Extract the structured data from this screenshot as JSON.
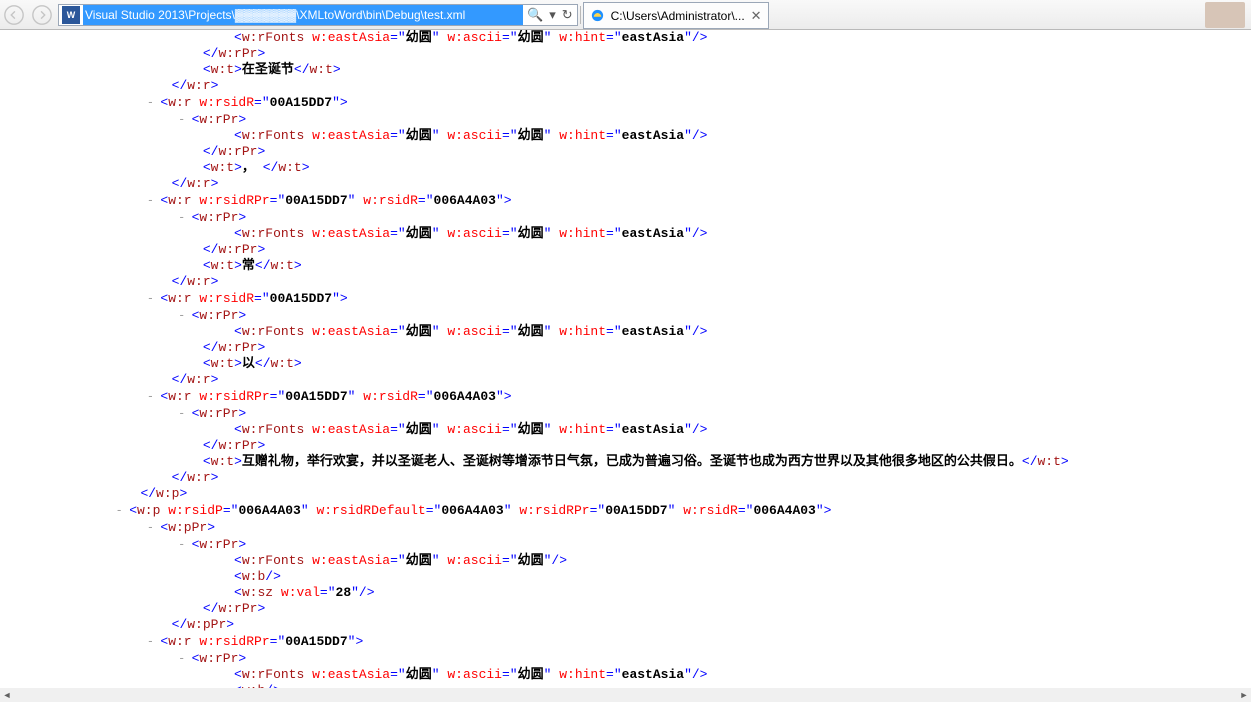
{
  "chrome": {
    "word_icon": "W",
    "address": "Visual Studio 2013\\Projects\\▓▓▓▓▓▓▓\\XMLtoWord\\bin\\Debug\\test.xml",
    "search_icon": "🔍",
    "dropdown_icon": "▾",
    "refresh_icon": "↻",
    "tab_title": "C:\\Users\\Administrator\\...",
    "tab_close": "✕"
  },
  "rsids": {
    "A15": "00A15DD7",
    "A03": "006A4A03"
  },
  "fonts": {
    "youyuan": "幼圆",
    "eastAsia": "eastAsia"
  },
  "text": {
    "t0": "在圣诞节",
    "t1": "，",
    "t2": "常",
    "t3": "以",
    "t4": "互赠礼物，举行欢宴，并以圣诞老人、圣诞树等增添节日气氛，已成为普遍习俗。圣诞节也成为西方世界以及其他很多地区的公共假日。"
  },
  "sz": "28",
  "tags": {
    "wr": "w:r",
    "wrPr": "w:rPr",
    "wrFonts": "w:rFonts",
    "wt": "w:t",
    "wp": "w:p",
    "wpPr": "w:pPr",
    "wb": "w:b",
    "wsz": "w:sz",
    "rsidR": "w:rsidR",
    "rsidRPr": "w:rsidRPr",
    "rsidP": "w:rsidP",
    "rsidRDefault": "w:rsidRDefault",
    "eastAsia": "w:eastAsia",
    "ascii": "w:ascii",
    "hint": "w:hint",
    "val": "w:val"
  }
}
